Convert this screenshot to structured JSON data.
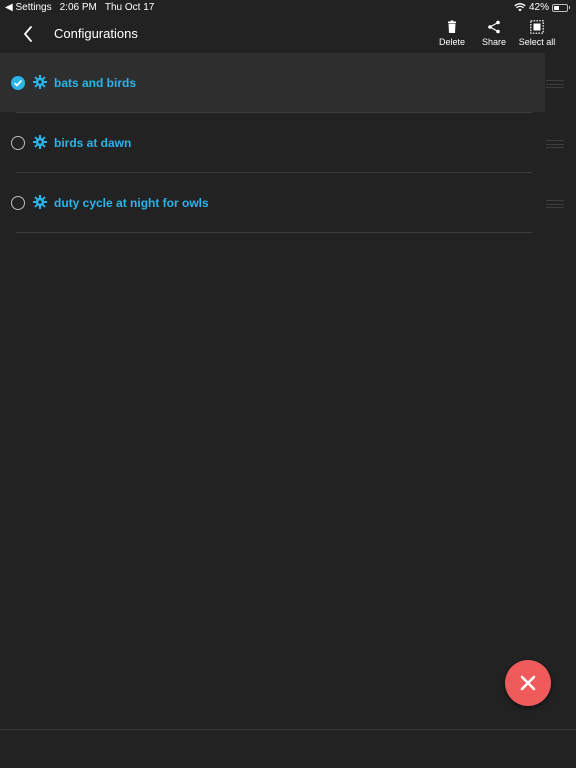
{
  "status_bar": {
    "back_app": "◀ Settings",
    "time": "2:06 PM",
    "date": "Thu Oct 17",
    "battery": "42%"
  },
  "header": {
    "title": "Configurations",
    "actions": {
      "delete": "Delete",
      "share": "Share",
      "select_all": "Select all"
    }
  },
  "configurations": [
    {
      "label": "bats and birds",
      "selected": true
    },
    {
      "label": "birds at dawn",
      "selected": false
    },
    {
      "label": "duty cycle at night for owls",
      "selected": false
    }
  ],
  "colors": {
    "accent": "#2bb4ea",
    "fab": "#ef5a5a",
    "background": "#222222"
  },
  "icons": {
    "back": "chevron-left-icon",
    "delete": "trash-icon",
    "share": "share-icon",
    "select_all": "select-all-icon",
    "config": "gear-icon",
    "fab": "close-icon"
  }
}
